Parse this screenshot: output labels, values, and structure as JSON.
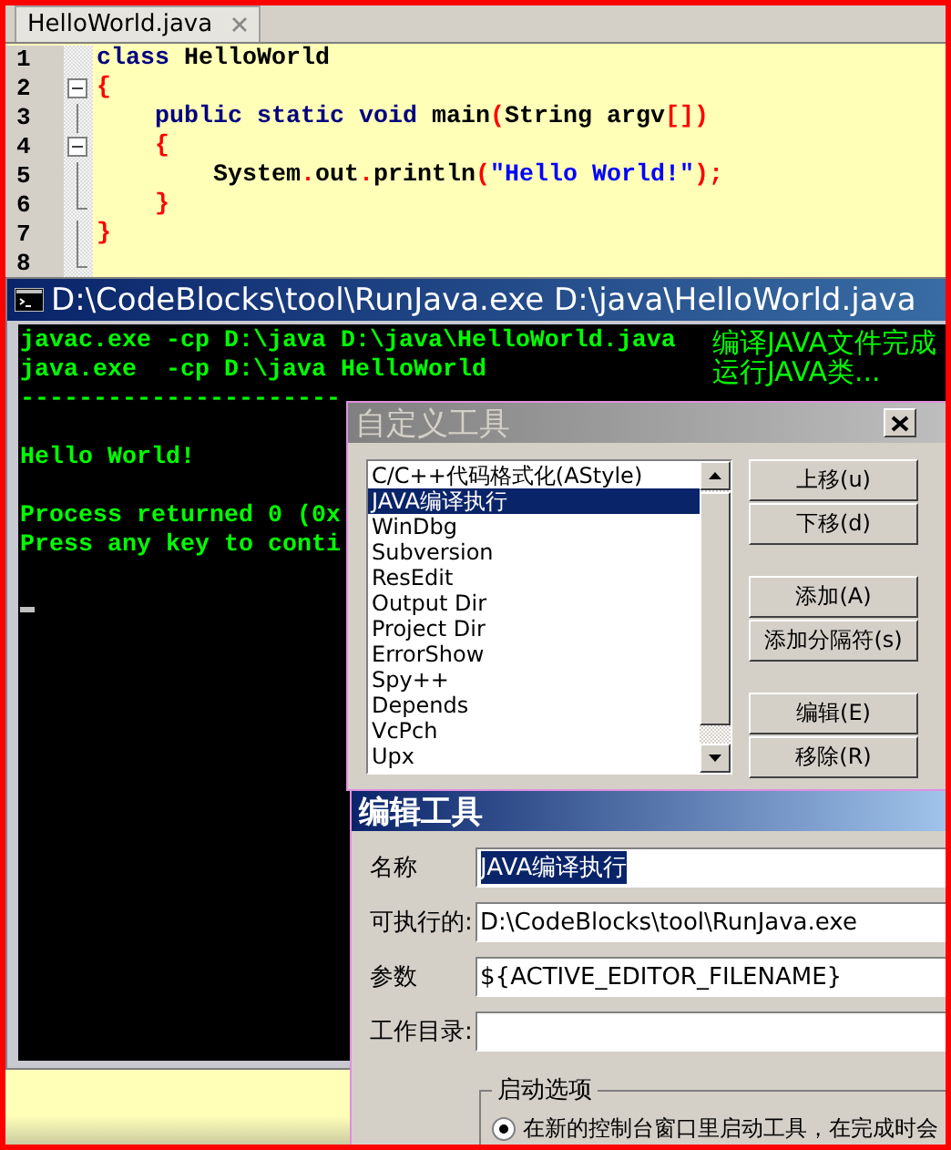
{
  "editor": {
    "tab": {
      "label": "HelloWorld.java"
    },
    "lines": [
      {
        "number": "1",
        "kind": "top",
        "fold_box": false,
        "fold_end": false,
        "fold_line": false,
        "tokens": [
          {
            "kind": "keyword",
            "text": "class"
          },
          {
            "kind": "plain",
            "text": " HelloWorld"
          }
        ]
      },
      {
        "number": "2",
        "kind": "top",
        "fold_box": true,
        "fold_end": false,
        "fold_line": false,
        "tokens": [
          {
            "kind": "punct",
            "text": "{"
          }
        ]
      },
      {
        "number": "3",
        "kind": "member",
        "fold_box": false,
        "fold_end": false,
        "fold_line": true,
        "tokens": [
          {
            "kind": "keyword",
            "text": "public static void"
          },
          {
            "kind": "plain",
            "text": " main"
          },
          {
            "kind": "punct",
            "text": "("
          },
          {
            "kind": "plain",
            "text": "String argv"
          },
          {
            "kind": "punct",
            "text": "[])"
          }
        ]
      },
      {
        "number": "4",
        "kind": "member",
        "fold_box": true,
        "fold_end": false,
        "fold_line": false,
        "tokens": [
          {
            "kind": "punct",
            "text": "{"
          }
        ]
      },
      {
        "number": "5",
        "kind": "statement",
        "fold_box": false,
        "fold_end": false,
        "fold_line": true,
        "tokens": [
          {
            "kind": "plain",
            "text": "System"
          },
          {
            "kind": "punct",
            "text": "."
          },
          {
            "kind": "plain",
            "text": "out"
          },
          {
            "kind": "punct",
            "text": "."
          },
          {
            "kind": "plain",
            "text": "println"
          },
          {
            "kind": "punct",
            "text": "("
          },
          {
            "kind": "string",
            "text": "\"Hello World!\""
          },
          {
            "kind": "punct",
            "text": ");"
          }
        ]
      },
      {
        "number": "6",
        "kind": "member",
        "fold_box": false,
        "fold_end": true,
        "fold_line": false,
        "tokens": [
          {
            "kind": "punct",
            "text": "}"
          }
        ]
      },
      {
        "number": "7",
        "kind": "top",
        "fold_box": false,
        "fold_end": false,
        "fold_line": true,
        "tokens": [
          {
            "kind": "punct",
            "text": "}"
          }
        ]
      },
      {
        "number": "8",
        "fold_box": false,
        "fold_end": true,
        "fold_line": false
      }
    ]
  },
  "console": {
    "title": "D:\\CodeBlocks\\tool\\RunJava.exe D:\\java\\HelloWorld.java",
    "lines": [
      {
        "kind": "text",
        "text": "javac.exe -cp D:\\java D:\\java\\HelloWorld.java",
        "note": "编译JAVA文件完成"
      },
      {
        "kind": "text",
        "text": "java.exe  -cp D:\\java HelloWorld",
        "note": "运行JAVA类..."
      },
      {
        "kind": "text",
        "text": "----------------------"
      },
      {
        "kind": "blank"
      },
      {
        "kind": "text",
        "text": "Hello World!"
      },
      {
        "kind": "blank"
      },
      {
        "kind": "text",
        "text": "Process returned 0 (0x"
      },
      {
        "kind": "text",
        "text": "Press any key to conti"
      },
      {
        "kind": "blank"
      },
      {
        "kind": "cursor"
      }
    ]
  },
  "tools_dialog": {
    "title": "自定义工具",
    "items": [
      {
        "label": "C/C++代码格式化(AStyle)",
        "selected": false
      },
      {
        "label": "JAVA编译执行",
        "selected": true
      },
      {
        "label": "WinDbg",
        "selected": false
      },
      {
        "label": "Subversion",
        "selected": false
      },
      {
        "label": "ResEdit",
        "selected": false
      },
      {
        "label": "Output Dir",
        "selected": false
      },
      {
        "label": "Project Dir",
        "selected": false
      },
      {
        "label": "ErrorShow",
        "selected": false
      },
      {
        "label": "Spy++",
        "selected": false
      },
      {
        "label": "Depends",
        "selected": false
      },
      {
        "label": "VcPch",
        "selected": false
      },
      {
        "label": "Upx",
        "selected": false
      }
    ],
    "button_groups": [
      [
        "上移(u)",
        "下移(d)"
      ],
      [
        "添加(A)",
        "添加分隔符(s)"
      ],
      [
        "编辑(E)",
        "移除(R)"
      ]
    ]
  },
  "edit_dialog": {
    "title": "编辑工具",
    "fields": [
      {
        "label": "名称",
        "value": "JAVA编译执行",
        "text_selected": true
      },
      {
        "label": "可执行的:",
        "value": "D:\\CodeBlocks\\tool\\RunJava.exe",
        "text_selected": false
      },
      {
        "label": "参数",
        "value": "${ACTIVE_EDITOR_FILENAME}",
        "text_selected": false
      },
      {
        "label": "工作目录:"
      }
    ],
    "group": {
      "title": "启动选项",
      "options": [
        {
          "label": "在新的控制台窗口里启动工具，在完成时会",
          "selected": true
        }
      ]
    }
  }
}
